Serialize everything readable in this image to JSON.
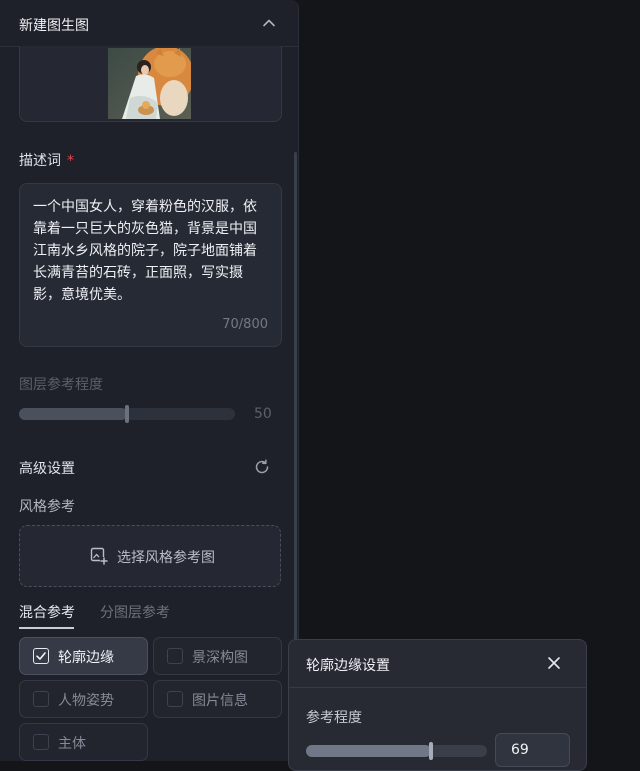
{
  "panel": {
    "title": "新建图生图"
  },
  "prompt": {
    "label": "描述词",
    "required_mark": "*",
    "text": "一个中国女人，穿着粉色的汉服，依靠着一只巨大的灰色猫，背景是中国江南水乡风格的院子，院子地面铺着长满青苔的石砖，正面照，写实摄影，意境优美。",
    "counter": "70/800"
  },
  "layer_reference": {
    "label": "图层参考程度",
    "value": "50",
    "fraction": 0.5
  },
  "advanced": {
    "label": "高级设置",
    "style_reference_label": "风格参考",
    "select_style_label": "选择风格参考图"
  },
  "tabs": [
    {
      "label": "混合参考",
      "active": true
    },
    {
      "label": "分图层参考",
      "active": false
    }
  ],
  "options": [
    {
      "label": "轮廓边缘",
      "checked": true
    },
    {
      "label": "景深构图",
      "checked": false
    },
    {
      "label": "人物姿势",
      "checked": false
    },
    {
      "label": "图片信息",
      "checked": false
    },
    {
      "label": "主体",
      "checked": false
    }
  ],
  "popover": {
    "title": "轮廓边缘设置",
    "param_label": "参考程度",
    "value": "69",
    "fraction": 0.69
  },
  "icons": {
    "collapse": "chevron-up-icon",
    "reset": "refresh-icon",
    "add_image": "image-add-icon",
    "close": "close-icon",
    "check": "checkmark-icon"
  }
}
